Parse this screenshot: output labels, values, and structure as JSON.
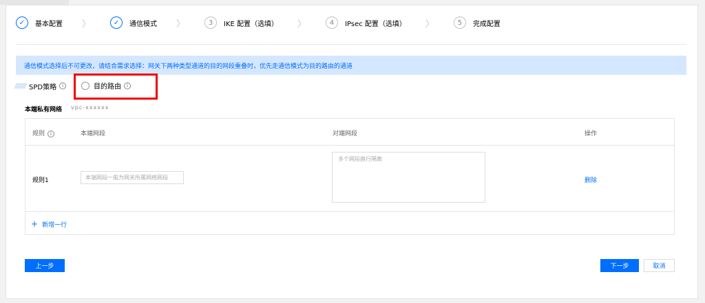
{
  "steps": [
    {
      "index": "",
      "label": "基本配置",
      "state": "done"
    },
    {
      "index": "",
      "label": "通信模式",
      "state": "done"
    },
    {
      "index": "3",
      "label": "IKE 配置（选填）",
      "state": "todo"
    },
    {
      "index": "4",
      "label": "IPsec 配置（选填）",
      "state": "todo"
    },
    {
      "index": "5",
      "label": "完成配置",
      "state": "todo"
    }
  ],
  "step_separator": "〉",
  "check_glyph": "✓",
  "alert": {
    "text": "通信模式选择后不可更改，请结合需求选择：网关下两种类型通道的目的网段重叠时，优先走通信模式为目的路由的通道"
  },
  "mode_options": {
    "spd_label": "SPD策略",
    "dest_route_label": "目的路由",
    "info_glyph": "i"
  },
  "private_network": {
    "label": "本端私有网络",
    "value": "vpc-xxxxxx"
  },
  "table": {
    "headers": {
      "rule": "规则",
      "local": "本端网段",
      "remote": "对端网段",
      "action": "操作"
    },
    "rows": [
      {
        "rule": "规则1",
        "local_placeholder": "本端网段一般为网关所属网络网段",
        "remote_placeholder": "多个网段换行隔离",
        "action": "删除"
      }
    ],
    "add_row_label": "新增一行",
    "add_glyph": "+"
  },
  "buttons": {
    "prev": "上一步",
    "next": "下一步",
    "cancel": "取消"
  },
  "colors": {
    "accent": "#006eff",
    "highlight": "#f00000",
    "alert_bg": "#d5e7ff"
  }
}
